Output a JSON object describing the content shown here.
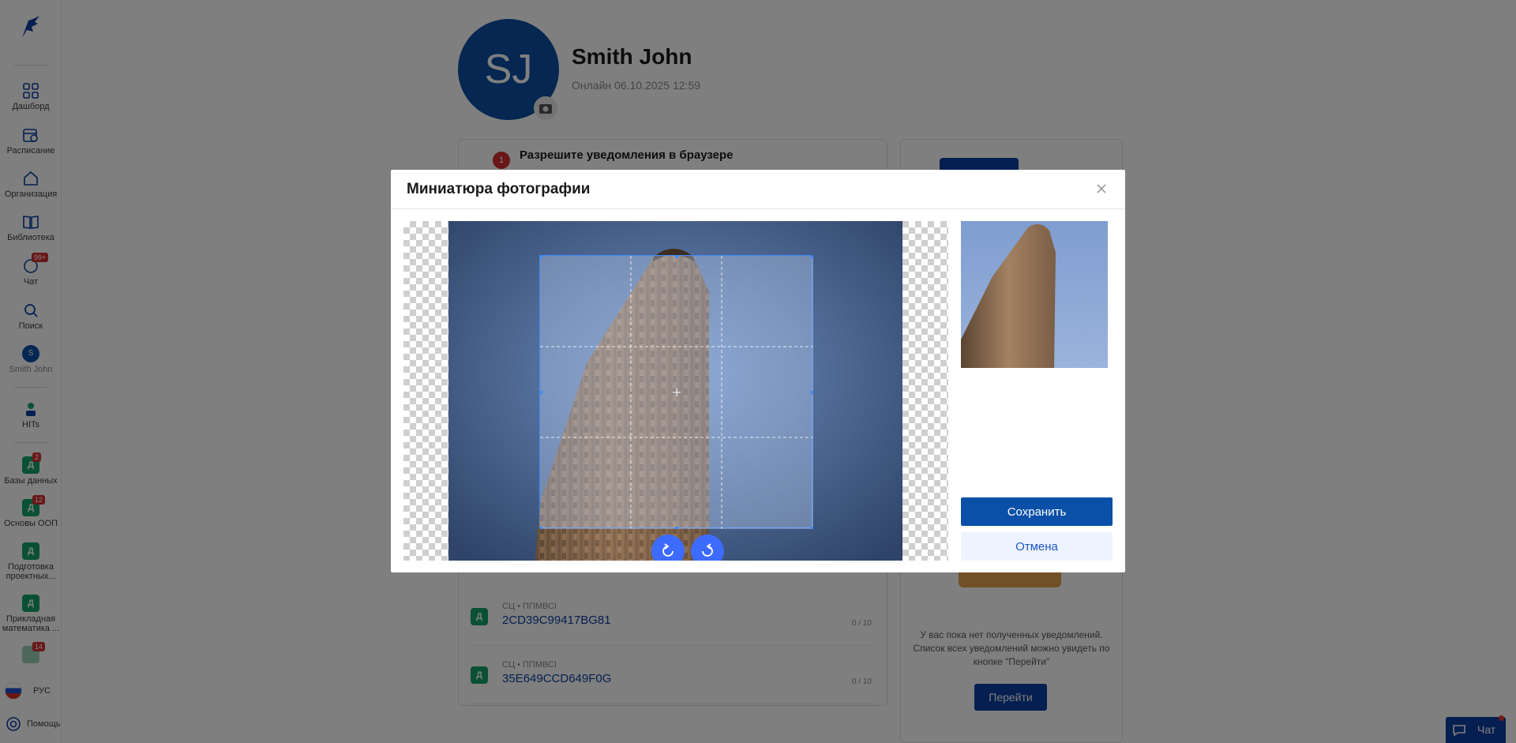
{
  "sidebar": {
    "items": [
      {
        "label": "Дашборд",
        "icon": "dashboard-icon"
      },
      {
        "label": "Расписание",
        "icon": "calendar-icon"
      },
      {
        "label": "Организация",
        "icon": "organization-icon"
      },
      {
        "label": "Библиотека",
        "icon": "library-icon"
      },
      {
        "label": "Чат",
        "icon": "chat-icon",
        "badge": "99+"
      },
      {
        "label": "Поиск",
        "icon": "search-icon"
      },
      {
        "label": "Smith John",
        "icon": "avatar-icon",
        "avatar_letter": "S"
      },
      {
        "label": "HITs",
        "icon": "hits-icon"
      },
      {
        "label": "Базы данных",
        "icon": "database-icon",
        "letter": "Д",
        "badge": "2"
      },
      {
        "label": "Основы ООП",
        "icon": "course-icon",
        "letter": "Д",
        "badge": "12"
      },
      {
        "label": "Подготовка проектных...",
        "icon": "course-icon",
        "letter": "Д"
      },
      {
        "label": "Прикладная математика ...",
        "icon": "course-icon",
        "letter": "Д"
      },
      {
        "label": "",
        "icon": "course-icon",
        "letter": "",
        "badge": "14"
      }
    ],
    "language": "РУС",
    "help": "Помощь"
  },
  "profile": {
    "initials": "SJ",
    "name": "Smith John",
    "status": "Онлайн 06.10.2025 12:59"
  },
  "notification": {
    "count": "1",
    "title": "Разрешите уведомления в браузере"
  },
  "tasks": [
    {
      "letter": "Д",
      "subtitle": "СЦ • ППМВСI",
      "code": "2CD39C99417BG81",
      "score": "0 / 10"
    },
    {
      "letter": "Д",
      "subtitle": "СЦ • ППМВСI",
      "code": "35E649CCD649F0G",
      "score": "0 / 10"
    }
  ],
  "notifications_panel": {
    "empty_text": "У вас пока нет полученных уведомлений. Список всех уведомлений можно увидеть по кнопке \"Перейти\"",
    "goto_button": "Перейти"
  },
  "chat_fab": {
    "label": "Чат"
  },
  "modal": {
    "title": "Миниатюра фотографии",
    "save_label": "Сохранить",
    "cancel_label": "Отмена",
    "rotate_left_icon": "rotate-left-icon",
    "rotate_right_icon": "rotate-right-icon"
  },
  "colors": {
    "primary": "#0a4fa8",
    "accent": "#3d6bff",
    "badge": "#d32f2f",
    "course": "#15a06a"
  }
}
